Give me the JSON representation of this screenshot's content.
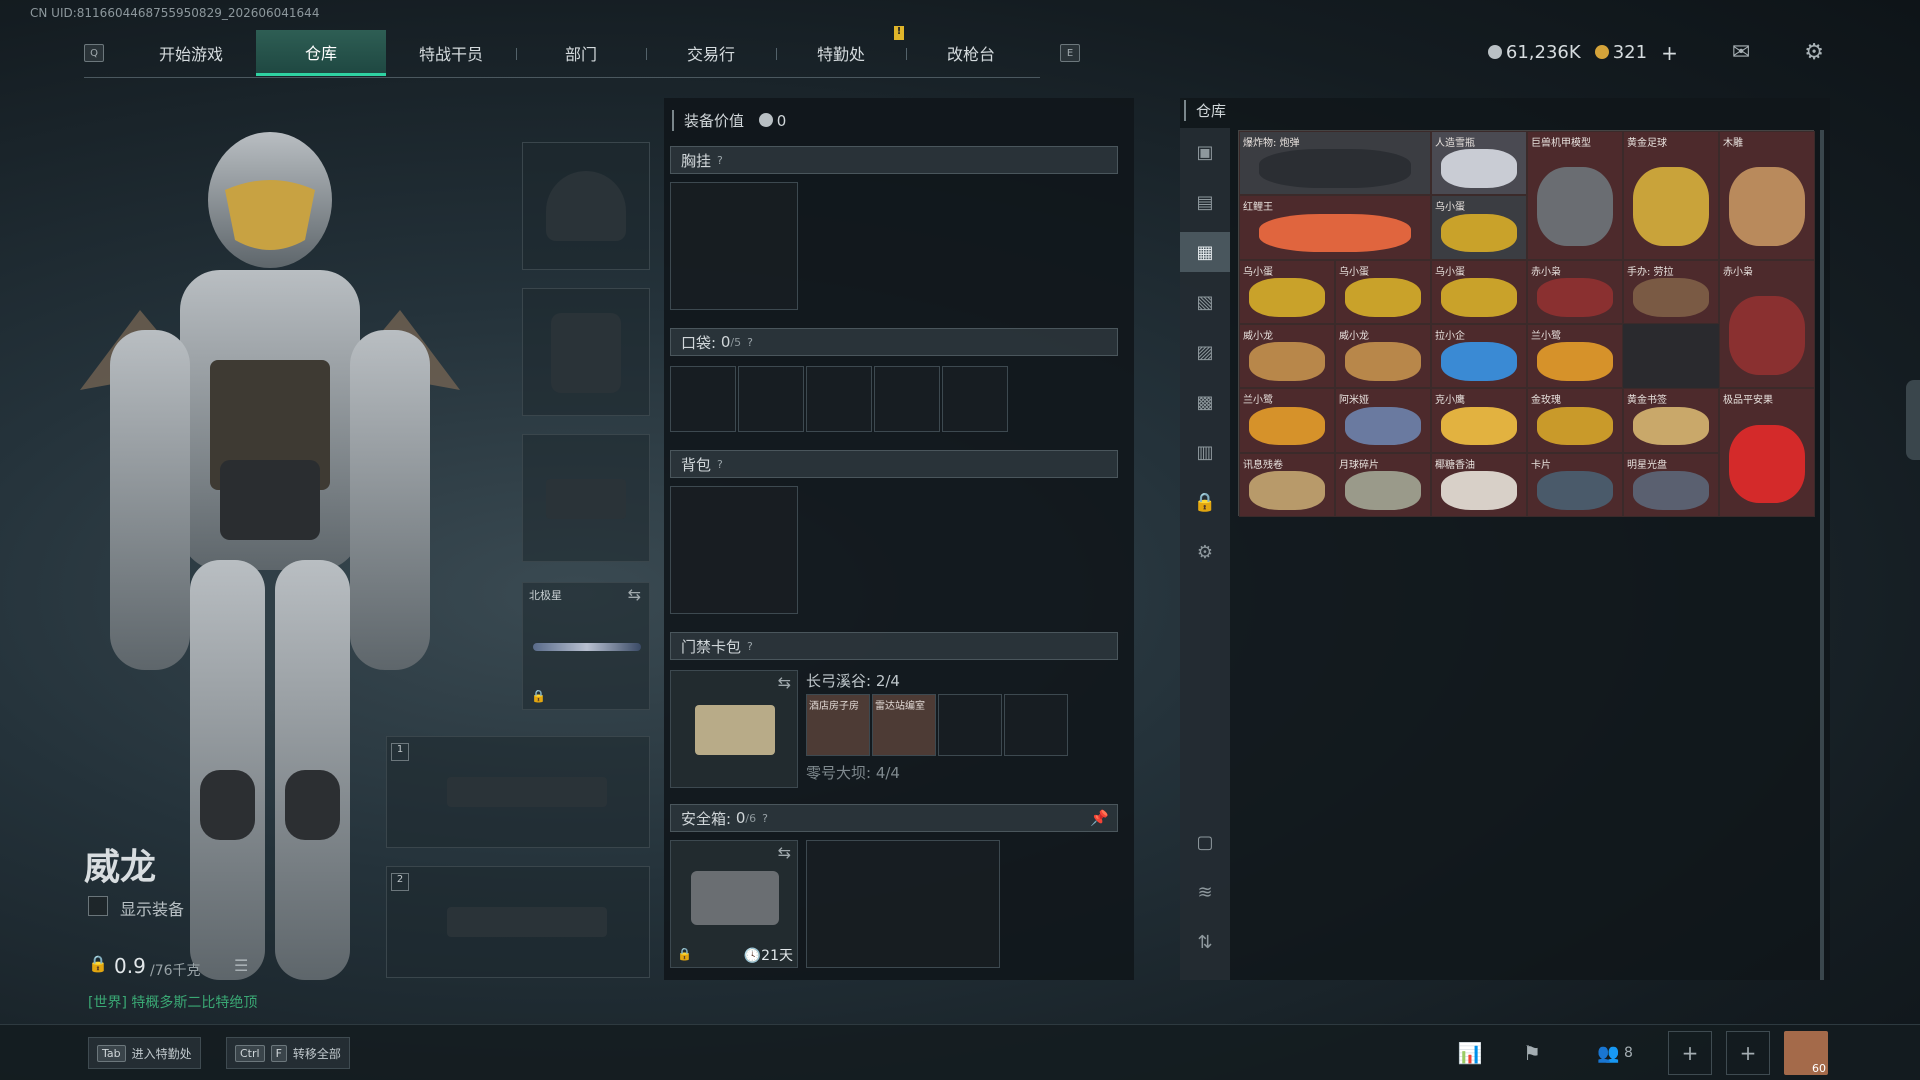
{
  "uid": "CN UID:8116604468755950829_202606041644",
  "nav": {
    "key_left": "Q",
    "key_right": "E",
    "tabs": [
      "开始游戏",
      "仓库",
      "特战干员",
      "部门",
      "交易行",
      "特勤处",
      "改枪台"
    ],
    "active": 1
  },
  "currency": {
    "silver": "61,236K",
    "gold": "321",
    "plus": "+",
    "silver_color": "#b9c0c4",
    "gold_color": "#d4a33a"
  },
  "operator": {
    "name": "威龙",
    "show_gear": "显示装备",
    "weight": "0.9",
    "weight_max": "/76千克",
    "chat": "[世界] 特概多斯二比特绝顶"
  },
  "loadout": {
    "sidearm_label": "北极星",
    "slot1": "1",
    "slot2": "2"
  },
  "equip": {
    "value_label": "装备价值",
    "value": "0",
    "chest": "胸挂",
    "pocket": "口袋:",
    "pocket_count": "0",
    "pocket_max": "/5",
    "backpack": "背包",
    "keycard": "门禁卡包",
    "keycard_line1": "长弓溪谷: 2/4",
    "keycard_line2": "零号大坝: 4/4",
    "key1": "酒店房子房",
    "key2": "雷达站编室",
    "safe": "安全箱:",
    "safe_count": "0",
    "safe_max": "/6",
    "safe_days": "21天",
    "q": "?"
  },
  "warehouse": {
    "title": "仓库",
    "items": [
      {
        "label": "爆炸物: 炮弹",
        "color": "#3b3d42",
        "art": "#2b2e33"
      },
      {
        "label": "人造雪瓶",
        "color": "#4a4a52",
        "art": "#c9ccd4"
      },
      {
        "label": "巨兽机甲模型",
        "color": "#4d2a2c",
        "art": "#6a6d72"
      },
      {
        "label": "黄金足球",
        "color": "#4d2a2c",
        "art": "#c9a33a"
      },
      {
        "label": "木雕",
        "color": "#4d2a2c",
        "art": "#b98a5c"
      },
      {
        "label": "红鲤王",
        "color": "#4d2a2c",
        "art": "#e0653e"
      },
      {
        "label": "乌小蛋",
        "color": "#3b3d42",
        "art": "#c9a22a"
      },
      {
        "label": "乌小蛋",
        "color": "#4d2a2c",
        "art": "#c9a22a"
      },
      {
        "label": "乌小蛋",
        "color": "#4d2a2c",
        "art": "#c9a22a"
      },
      {
        "label": "乌小蛋",
        "color": "#4d2a2c",
        "art": "#c9a22a"
      },
      {
        "label": "赤小枭",
        "color": "#4d2a2c",
        "art": "#8a3030"
      },
      {
        "label": "手办: 劳拉",
        "color": "#4d2a2c",
        "art": "#7a5a44"
      },
      {
        "label": "赤小枭",
        "color": "#4d2a2c",
        "art": "#8a3030"
      },
      {
        "label": "威小龙",
        "color": "#4d2a2c",
        "art": "#b8874a"
      },
      {
        "label": "威小龙",
        "color": "#4d2a2c",
        "art": "#b8874a"
      },
      {
        "label": "拉小企",
        "color": "#4d2a2c",
        "art": "#3a8ad4"
      },
      {
        "label": "兰小鹭",
        "color": "#4d2a2c",
        "art": "#d6922a"
      },
      {
        "label": "兰小鹭",
        "color": "#4d2a2c",
        "art": "#d6922a"
      },
      {
        "label": "阿米娅",
        "color": "#4d2a2c",
        "art": "#6a7aa0"
      },
      {
        "label": "克小鹰",
        "color": "#4d2a2c",
        "art": "#e2b240"
      },
      {
        "label": "金玫瑰",
        "color": "#4d2a2c",
        "art": "#c99a2a"
      },
      {
        "label": "黄金书签",
        "color": "#4d2a2c",
        "art": "#c9a86a"
      },
      {
        "label": "极品平安果",
        "color": "#4d2a2c",
        "art": "#d42a2a"
      },
      {
        "label": "讯息残卷",
        "color": "#4d2a2c",
        "art": "#b89a6a"
      },
      {
        "label": "月球碎片",
        "color": "#4d2a2c",
        "art": "#9a9a8a"
      },
      {
        "label": "椰糖香油",
        "color": "#4d2a2c",
        "art": "#d8d0c8"
      },
      {
        "label": "卡片",
        "color": "#4d2a2c",
        "art": "#4a5a6a"
      },
      {
        "label": "明星光盘",
        "color": "#4d2a2c",
        "art": "#5a6070"
      }
    ]
  },
  "bottom": {
    "tab_key": "Tab",
    "tab_label": "进入特勤处",
    "ctrl_key": "Ctrl",
    "f_key": "F",
    "transfer_label": "转移全部",
    "friends": "8",
    "avatar_level": "60"
  }
}
